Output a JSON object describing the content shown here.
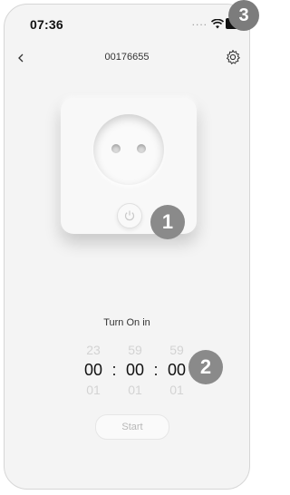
{
  "status_bar": {
    "time": "07:36",
    "signal_dots": "....",
    "battery_label": "6"
  },
  "header": {
    "title": "00176655"
  },
  "icons": {
    "back": "chevron-left-icon",
    "settings": "gear-icon",
    "power": "power-icon",
    "wifi": "wifi-icon"
  },
  "timer": {
    "label": "Turn On in",
    "prev": {
      "hours": "23",
      "minutes": "59",
      "seconds": "59"
    },
    "current": {
      "hours": "00",
      "minutes": "00",
      "seconds": "00"
    },
    "next": {
      "hours": "01",
      "minutes": "01",
      "seconds": "01"
    },
    "separator": ":"
  },
  "start_button": {
    "label": "Start"
  },
  "callouts": {
    "one": "1",
    "two": "2",
    "three": "3"
  },
  "colors": {
    "background": "#f4f4f4",
    "callout": "#8a8a8a"
  }
}
